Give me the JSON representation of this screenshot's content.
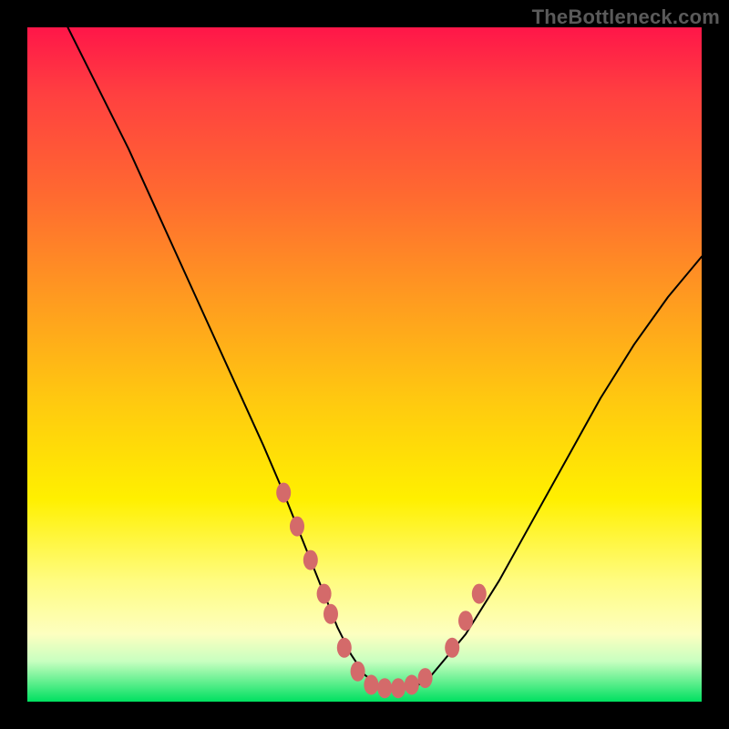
{
  "watermark": "TheBottleneck.com",
  "chart_data": {
    "type": "line",
    "title": "",
    "xlabel": "",
    "ylabel": "",
    "xlim": [
      0,
      100
    ],
    "ylim": [
      0,
      100
    ],
    "series": [
      {
        "name": "curve",
        "x": [
          6,
          10,
          15,
          20,
          25,
          30,
          35,
          38,
          40,
          42,
          44,
          46,
          48,
          50,
          52,
          54,
          56,
          58,
          60,
          65,
          70,
          75,
          80,
          85,
          90,
          95,
          100
        ],
        "y": [
          100,
          92,
          82,
          71,
          60,
          49,
          38,
          31,
          26,
          21,
          16,
          11,
          7,
          4,
          2.5,
          2,
          2,
          2.5,
          4,
          10,
          18,
          27,
          36,
          45,
          53,
          60,
          66
        ]
      }
    ],
    "markers": {
      "name": "highlight-points",
      "color": "#d46a6a",
      "x": [
        38,
        40,
        42,
        44,
        45,
        47,
        49,
        51,
        53,
        55,
        57,
        59,
        63,
        65,
        67
      ],
      "y": [
        31,
        26,
        21,
        16,
        13,
        8,
        4.5,
        2.5,
        2,
        2,
        2.5,
        3.5,
        8,
        12,
        16
      ]
    },
    "gradient_stops": [
      {
        "pos": 0.0,
        "color": "#ff1649"
      },
      {
        "pos": 0.1,
        "color": "#ff4040"
      },
      {
        "pos": 0.25,
        "color": "#ff6a30"
      },
      {
        "pos": 0.4,
        "color": "#ff9a20"
      },
      {
        "pos": 0.55,
        "color": "#ffc810"
      },
      {
        "pos": 0.7,
        "color": "#fff000"
      },
      {
        "pos": 0.82,
        "color": "#fffc80"
      },
      {
        "pos": 0.9,
        "color": "#fdffc0"
      },
      {
        "pos": 0.94,
        "color": "#c8ffc0"
      },
      {
        "pos": 1.0,
        "color": "#00e060"
      }
    ]
  }
}
